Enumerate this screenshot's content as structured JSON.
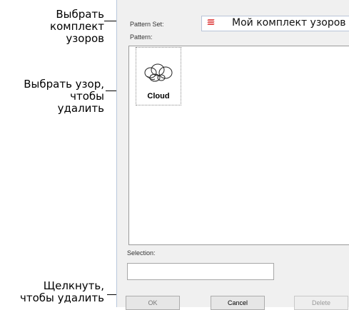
{
  "callouts": {
    "choose_set": [
      "Выбрать",
      "комплект",
      "узоров"
    ],
    "choose_pattern": [
      "Выбрать узор,",
      "чтобы",
      "удалить"
    ],
    "click_delete": [
      "Щелкнуть,",
      "чтобы удалить"
    ]
  },
  "dialog": {
    "pattern_set_label": "Pattern Set:",
    "pattern_set_value": "Мой комплект узоров",
    "pattern_set_icon": "pattern-set-icon",
    "pattern_label": "Pattern:",
    "patterns": [
      {
        "name": "Cloud",
        "icon": "cloud-pattern-icon"
      }
    ],
    "selection_label": "Selection:",
    "selection_value": "",
    "buttons": {
      "ok": "OK",
      "cancel": "Cancel",
      "delete": "Delete"
    }
  },
  "colors": {
    "set_icon_red": "#e25454",
    "dialog_bg": "#f0f0f0"
  }
}
